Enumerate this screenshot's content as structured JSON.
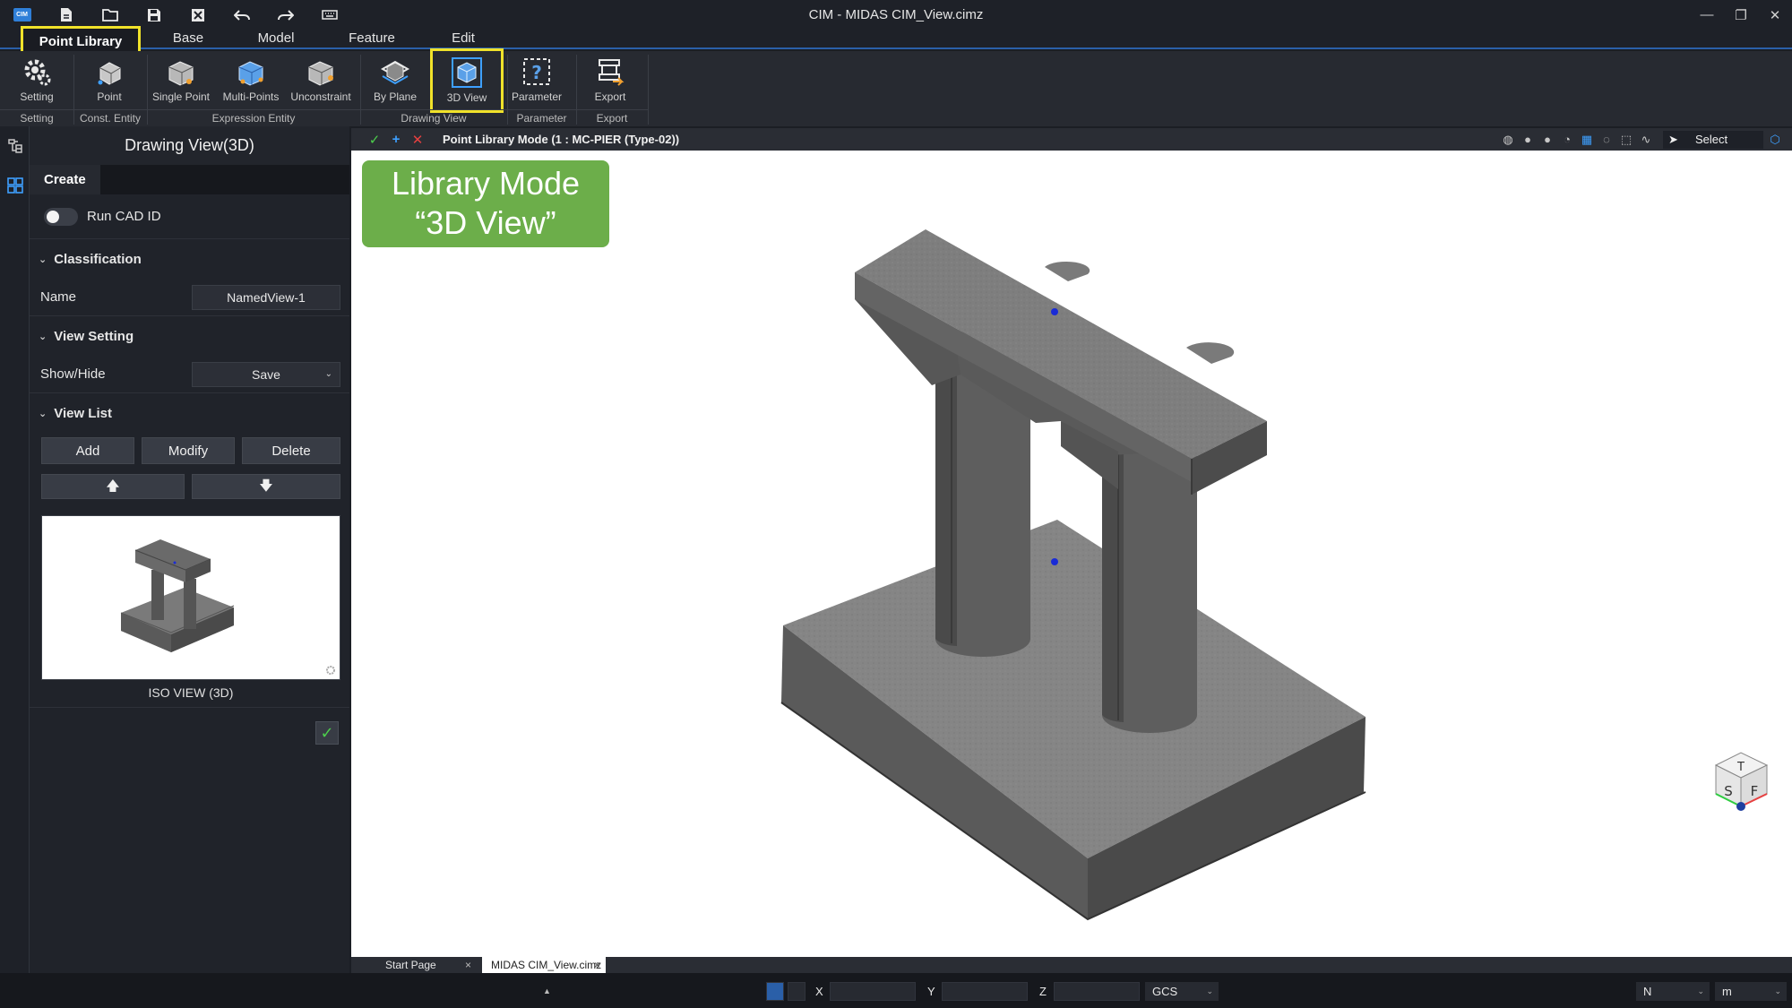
{
  "window": {
    "title": "CIM - MIDAS CIM_View.cimz",
    "app_logo": "CIM"
  },
  "quick_access": [
    "new-file-icon",
    "open-folder-icon",
    "save-icon",
    "close-file-icon",
    "undo-icon",
    "redo-icon",
    "keyboard-icon"
  ],
  "menu": {
    "tabs": [
      "Point Library",
      "Base",
      "Model",
      "Feature",
      "Edit"
    ],
    "active": "Point Library"
  },
  "ribbon": {
    "buttons": {
      "setting": "Setting",
      "point": "Point",
      "single_point": "Single Point",
      "multi_points": "Multi-Points",
      "unconstraint": "Unconstraint",
      "by_plane": "By Plane",
      "view_3d": "3D View",
      "parameter": "Parameter",
      "export": "Export"
    },
    "groups": {
      "setting": "Setting",
      "const_entity": "Const. Entity",
      "expression_entity": "Expression Entity",
      "drawing_view": "Drawing View",
      "parameter": "Parameter",
      "export": "Export"
    }
  },
  "panel": {
    "title": "Drawing View(3D)",
    "tab": "Create",
    "run_cad_id": "Run CAD ID",
    "classification": {
      "header": "Classification",
      "name_label": "Name",
      "name_value": "NamedView-1"
    },
    "view_setting": {
      "header": "View Setting",
      "label": "Show/Hide",
      "value": "Save"
    },
    "view_list": {
      "header": "View List",
      "add": "Add",
      "modify": "Modify",
      "delete": "Delete",
      "up": "🡅",
      "down": "🡇",
      "thumb_label": "ISO VIEW (3D)"
    }
  },
  "viewport": {
    "mode_text": "Point Library Mode (1 : MC-PIER (Type-02))",
    "select_label": "Select",
    "callout_line1": "Library Mode",
    "callout_line2": "“3D View”",
    "cube_faces": {
      "top": "T",
      "left": "S",
      "right": "F"
    }
  },
  "doc_tabs": [
    "Start Page",
    "MIDAS CIM_View.cimz"
  ],
  "status": {
    "x": "X",
    "y": "Y",
    "z": "Z",
    "coord_system": "GCS",
    "force_unit": "N",
    "length_unit": "m"
  },
  "colors": {
    "accent": "#2a5fa8",
    "highlight": "#f0e22a",
    "callout": "#6cae4a",
    "concrete": "#6a6a6a"
  }
}
